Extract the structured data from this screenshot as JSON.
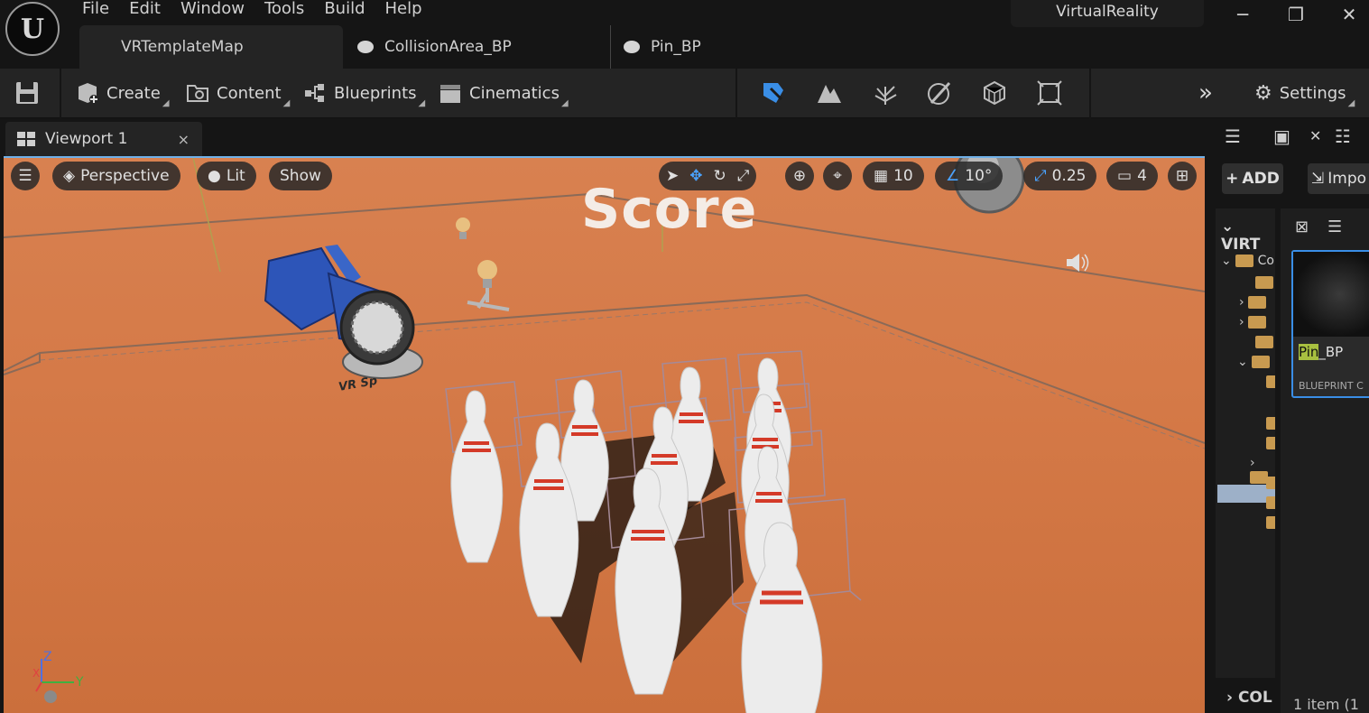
{
  "app": {
    "logo_letter": "U",
    "menu": [
      "File",
      "Edit",
      "Window",
      "Tools",
      "Build",
      "Help"
    ],
    "project_name": "VirtualReality",
    "window_controls": {
      "minimize": "─",
      "restore": "❐",
      "close": "✕"
    }
  },
  "document_tabs": [
    {
      "label": "VRTemplateMap",
      "active": true
    },
    {
      "label": "CollisionArea_BP",
      "active": false
    },
    {
      "label": "Pin_BP",
      "active": false
    }
  ],
  "toolbar": {
    "create": "Create",
    "content": "Content",
    "blueprints": "Blueprints",
    "cinematics": "Cinematics",
    "settings": "Settings",
    "mode_icons": [
      "select-mode-icon",
      "landscape-icon",
      "foliage-icon",
      "mesh-paint-icon",
      "fracture-icon",
      "modeling-icon"
    ]
  },
  "viewport_tab": {
    "label": "Viewport 1",
    "close": "×"
  },
  "viewport": {
    "perspective": "Perspective",
    "lit": "Lit",
    "show": "Show",
    "grid_snap": "10",
    "rotation_snap": "10°",
    "scale_snap": "0.25",
    "camera_speed": "4",
    "scene_text": "Score",
    "camera_label": "VR Sp",
    "axis": {
      "z": "Z",
      "x": "X",
      "y": "Y"
    }
  },
  "content_browser": {
    "add": "ADD",
    "import": "Impo",
    "tree_header": "VIRT",
    "tree_root": "Co",
    "collections": "COL",
    "asset_name_highlight": "Pin",
    "asset_name_rest": "_BP",
    "asset_type": "BLUEPRINT C",
    "item_count": "1 item (1"
  },
  "colors": {
    "viewport_floor": "#d57a48",
    "selection_blue": "#3a8ee6",
    "search_highlight": "#a8c040"
  }
}
